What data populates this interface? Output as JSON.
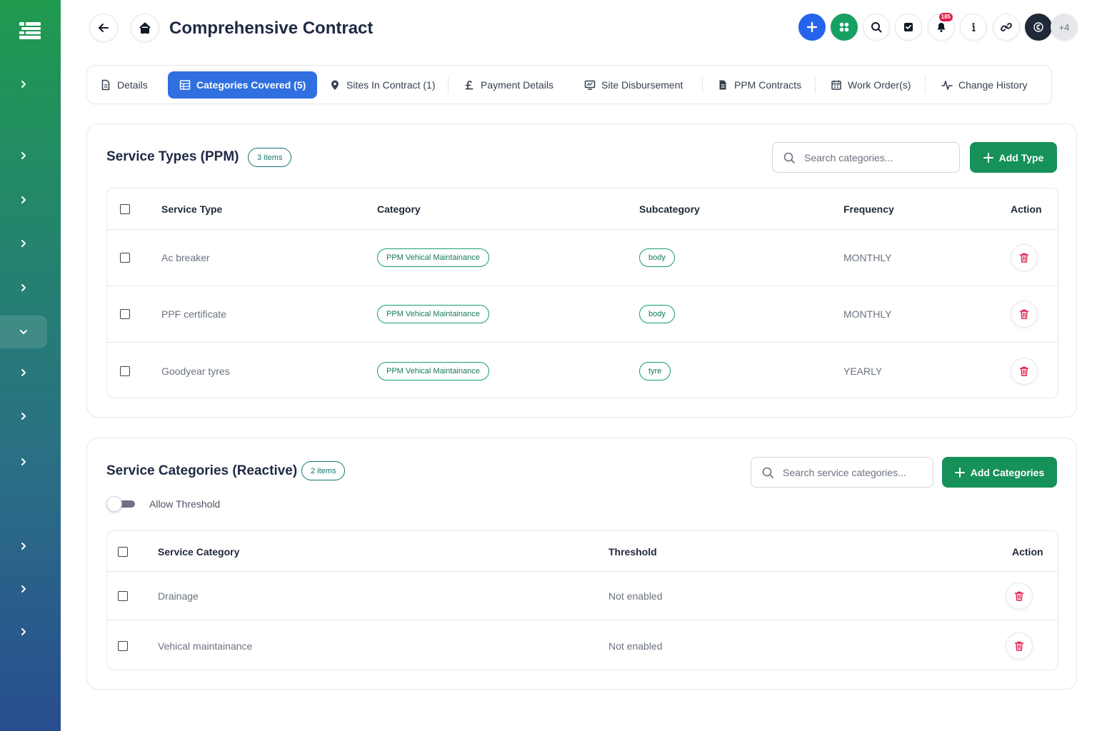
{
  "header": {
    "title": "Comprehensive Contract",
    "notification_count": "185",
    "avatar_more": "+4"
  },
  "tabs": [
    {
      "label": "Details",
      "icon": "document-icon"
    },
    {
      "label": "Categories Covered (5)",
      "icon": "grid-icon",
      "active": true
    },
    {
      "label": "Sites In Contract (1)",
      "icon": "map-pin-icon"
    },
    {
      "label": "Payment Details",
      "icon": "pound-icon"
    },
    {
      "label": "Site Disbursement",
      "icon": "monitor-icon"
    },
    {
      "label": "PPM Contracts",
      "icon": "file-icon"
    },
    {
      "label": "Work Order(s)",
      "icon": "calendar-icon"
    },
    {
      "label": "Change History",
      "icon": "activity-icon"
    }
  ],
  "ppm": {
    "title": "Service Types (PPM)",
    "count": "3 items",
    "search_placeholder": "Search categories...",
    "add_label": "Add Type",
    "columns": [
      "Service Type",
      "Category",
      "Subcategory",
      "Frequency",
      "Action"
    ],
    "rows": [
      {
        "service_type": "Ac breaker",
        "category": "PPM Vehical Maintainance",
        "subcategory": "body",
        "frequency": "MONTHLY"
      },
      {
        "service_type": "PPF certificate",
        "category": "PPM Vehical Maintainance",
        "subcategory": "body",
        "frequency": "MONTHLY"
      },
      {
        "service_type": "Goodyear tyres",
        "category": "PPM Vehical Maintainance",
        "subcategory": "tyre",
        "frequency": "YEARLY"
      }
    ]
  },
  "reactive": {
    "title": "Service Categories (Reactive)",
    "count": "2 items",
    "search_placeholder": "Search service categories...",
    "add_label": "Add Categories",
    "toggle_label": "Allow Threshold",
    "columns": [
      "Service Category",
      "Threshold",
      "Action"
    ],
    "rows": [
      {
        "category": "Drainage",
        "threshold": "Not enabled"
      },
      {
        "category": "Vehical maintainance",
        "threshold": "Not enabled"
      }
    ]
  },
  "colors": {
    "primary_blue": "#2f6fe0",
    "brand_green": "#17915a",
    "delete_red": "#e11d48"
  }
}
